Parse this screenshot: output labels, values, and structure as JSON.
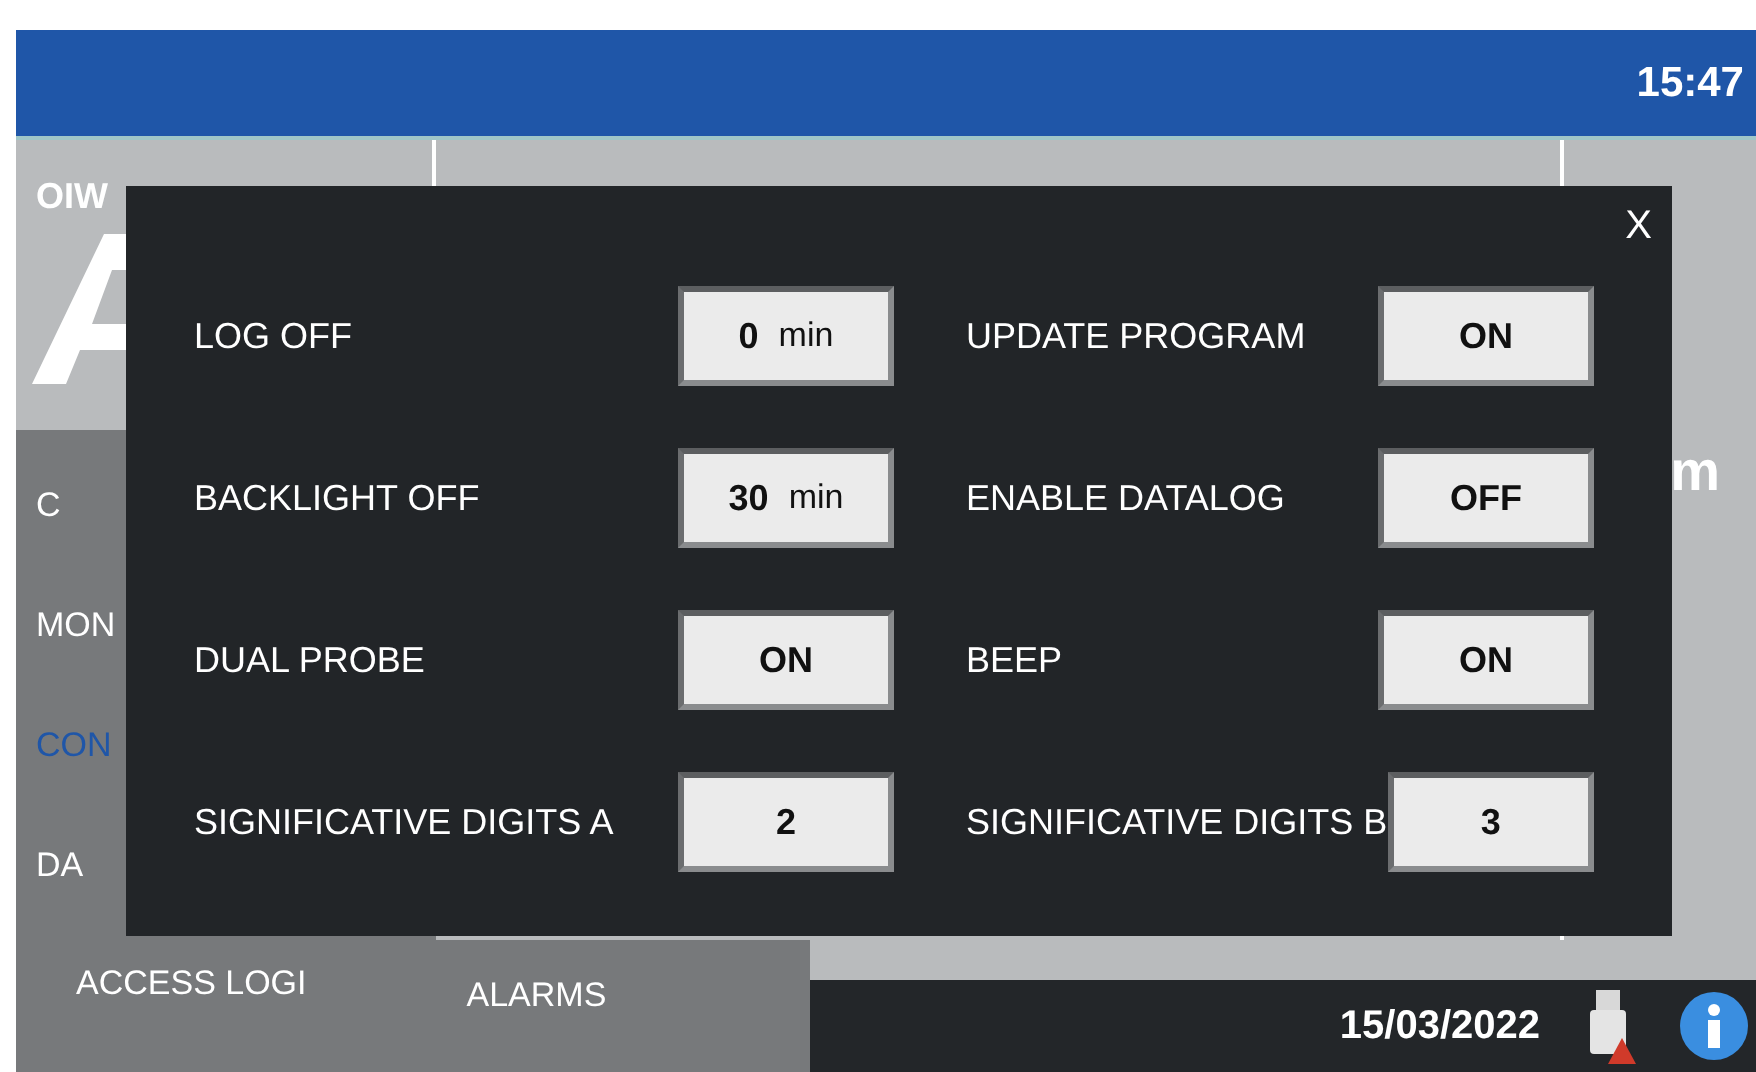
{
  "header": {
    "time": "15:47"
  },
  "logo": {
    "brand": "OIW"
  },
  "nav": [
    {
      "label": "C",
      "selected": false
    },
    {
      "label": "MON",
      "selected": false
    },
    {
      "label": "CON",
      "selected": true
    },
    {
      "label": "DA",
      "selected": false
    }
  ],
  "bottom_tabs": [
    "ACCESS LOGI",
    "ALARMS"
  ],
  "right_fragments": [
    "m"
  ],
  "status_bar": {
    "date": "15/03/2022"
  },
  "dialog": {
    "close": "X",
    "left": [
      {
        "label": "LOG OFF",
        "value": "0",
        "unit": "min"
      },
      {
        "label": "BACKLIGHT OFF",
        "value": "30",
        "unit": "min"
      },
      {
        "label": "DUAL PROBE",
        "value": "ON"
      },
      {
        "label": "SIGNIFICATIVE DIGITS A",
        "value": "2"
      }
    ],
    "right": [
      {
        "label": "UPDATE PROGRAM",
        "value": "ON"
      },
      {
        "label": "ENABLE DATALOG",
        "value": "OFF"
      },
      {
        "label": "BEEP",
        "value": "ON"
      },
      {
        "label": "SIGNIFICATIVE DIGITS B",
        "value": "3"
      }
    ]
  }
}
